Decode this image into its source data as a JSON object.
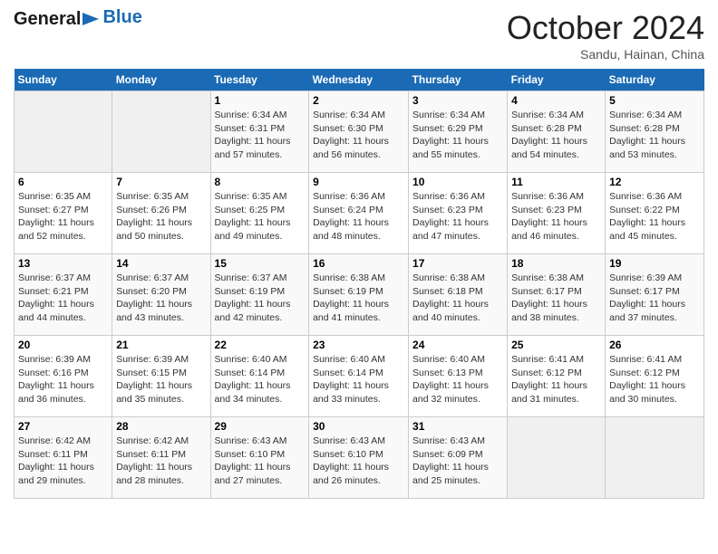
{
  "header": {
    "logo_general": "General",
    "logo_blue": "Blue",
    "month_title": "October 2024",
    "location": "Sandu, Hainan, China"
  },
  "days_of_week": [
    "Sunday",
    "Monday",
    "Tuesday",
    "Wednesday",
    "Thursday",
    "Friday",
    "Saturday"
  ],
  "weeks": [
    [
      {
        "day": "",
        "sunrise": "",
        "sunset": "",
        "daylight": ""
      },
      {
        "day": "",
        "sunrise": "",
        "sunset": "",
        "daylight": ""
      },
      {
        "day": "1",
        "sunrise": "Sunrise: 6:34 AM",
        "sunset": "Sunset: 6:31 PM",
        "daylight": "Daylight: 11 hours and 57 minutes."
      },
      {
        "day": "2",
        "sunrise": "Sunrise: 6:34 AM",
        "sunset": "Sunset: 6:30 PM",
        "daylight": "Daylight: 11 hours and 56 minutes."
      },
      {
        "day": "3",
        "sunrise": "Sunrise: 6:34 AM",
        "sunset": "Sunset: 6:29 PM",
        "daylight": "Daylight: 11 hours and 55 minutes."
      },
      {
        "day": "4",
        "sunrise": "Sunrise: 6:34 AM",
        "sunset": "Sunset: 6:28 PM",
        "daylight": "Daylight: 11 hours and 54 minutes."
      },
      {
        "day": "5",
        "sunrise": "Sunrise: 6:34 AM",
        "sunset": "Sunset: 6:28 PM",
        "daylight": "Daylight: 11 hours and 53 minutes."
      }
    ],
    [
      {
        "day": "6",
        "sunrise": "Sunrise: 6:35 AM",
        "sunset": "Sunset: 6:27 PM",
        "daylight": "Daylight: 11 hours and 52 minutes."
      },
      {
        "day": "7",
        "sunrise": "Sunrise: 6:35 AM",
        "sunset": "Sunset: 6:26 PM",
        "daylight": "Daylight: 11 hours and 50 minutes."
      },
      {
        "day": "8",
        "sunrise": "Sunrise: 6:35 AM",
        "sunset": "Sunset: 6:25 PM",
        "daylight": "Daylight: 11 hours and 49 minutes."
      },
      {
        "day": "9",
        "sunrise": "Sunrise: 6:36 AM",
        "sunset": "Sunset: 6:24 PM",
        "daylight": "Daylight: 11 hours and 48 minutes."
      },
      {
        "day": "10",
        "sunrise": "Sunrise: 6:36 AM",
        "sunset": "Sunset: 6:23 PM",
        "daylight": "Daylight: 11 hours and 47 minutes."
      },
      {
        "day": "11",
        "sunrise": "Sunrise: 6:36 AM",
        "sunset": "Sunset: 6:23 PM",
        "daylight": "Daylight: 11 hours and 46 minutes."
      },
      {
        "day": "12",
        "sunrise": "Sunrise: 6:36 AM",
        "sunset": "Sunset: 6:22 PM",
        "daylight": "Daylight: 11 hours and 45 minutes."
      }
    ],
    [
      {
        "day": "13",
        "sunrise": "Sunrise: 6:37 AM",
        "sunset": "Sunset: 6:21 PM",
        "daylight": "Daylight: 11 hours and 44 minutes."
      },
      {
        "day": "14",
        "sunrise": "Sunrise: 6:37 AM",
        "sunset": "Sunset: 6:20 PM",
        "daylight": "Daylight: 11 hours and 43 minutes."
      },
      {
        "day": "15",
        "sunrise": "Sunrise: 6:37 AM",
        "sunset": "Sunset: 6:19 PM",
        "daylight": "Daylight: 11 hours and 42 minutes."
      },
      {
        "day": "16",
        "sunrise": "Sunrise: 6:38 AM",
        "sunset": "Sunset: 6:19 PM",
        "daylight": "Daylight: 11 hours and 41 minutes."
      },
      {
        "day": "17",
        "sunrise": "Sunrise: 6:38 AM",
        "sunset": "Sunset: 6:18 PM",
        "daylight": "Daylight: 11 hours and 40 minutes."
      },
      {
        "day": "18",
        "sunrise": "Sunrise: 6:38 AM",
        "sunset": "Sunset: 6:17 PM",
        "daylight": "Daylight: 11 hours and 38 minutes."
      },
      {
        "day": "19",
        "sunrise": "Sunrise: 6:39 AM",
        "sunset": "Sunset: 6:17 PM",
        "daylight": "Daylight: 11 hours and 37 minutes."
      }
    ],
    [
      {
        "day": "20",
        "sunrise": "Sunrise: 6:39 AM",
        "sunset": "Sunset: 6:16 PM",
        "daylight": "Daylight: 11 hours and 36 minutes."
      },
      {
        "day": "21",
        "sunrise": "Sunrise: 6:39 AM",
        "sunset": "Sunset: 6:15 PM",
        "daylight": "Daylight: 11 hours and 35 minutes."
      },
      {
        "day": "22",
        "sunrise": "Sunrise: 6:40 AM",
        "sunset": "Sunset: 6:14 PM",
        "daylight": "Daylight: 11 hours and 34 minutes."
      },
      {
        "day": "23",
        "sunrise": "Sunrise: 6:40 AM",
        "sunset": "Sunset: 6:14 PM",
        "daylight": "Daylight: 11 hours and 33 minutes."
      },
      {
        "day": "24",
        "sunrise": "Sunrise: 6:40 AM",
        "sunset": "Sunset: 6:13 PM",
        "daylight": "Daylight: 11 hours and 32 minutes."
      },
      {
        "day": "25",
        "sunrise": "Sunrise: 6:41 AM",
        "sunset": "Sunset: 6:12 PM",
        "daylight": "Daylight: 11 hours and 31 minutes."
      },
      {
        "day": "26",
        "sunrise": "Sunrise: 6:41 AM",
        "sunset": "Sunset: 6:12 PM",
        "daylight": "Daylight: 11 hours and 30 minutes."
      }
    ],
    [
      {
        "day": "27",
        "sunrise": "Sunrise: 6:42 AM",
        "sunset": "Sunset: 6:11 PM",
        "daylight": "Daylight: 11 hours and 29 minutes."
      },
      {
        "day": "28",
        "sunrise": "Sunrise: 6:42 AM",
        "sunset": "Sunset: 6:11 PM",
        "daylight": "Daylight: 11 hours and 28 minutes."
      },
      {
        "day": "29",
        "sunrise": "Sunrise: 6:43 AM",
        "sunset": "Sunset: 6:10 PM",
        "daylight": "Daylight: 11 hours and 27 minutes."
      },
      {
        "day": "30",
        "sunrise": "Sunrise: 6:43 AM",
        "sunset": "Sunset: 6:10 PM",
        "daylight": "Daylight: 11 hours and 26 minutes."
      },
      {
        "day": "31",
        "sunrise": "Sunrise: 6:43 AM",
        "sunset": "Sunset: 6:09 PM",
        "daylight": "Daylight: 11 hours and 25 minutes."
      },
      {
        "day": "",
        "sunrise": "",
        "sunset": "",
        "daylight": ""
      },
      {
        "day": "",
        "sunrise": "",
        "sunset": "",
        "daylight": ""
      }
    ]
  ]
}
